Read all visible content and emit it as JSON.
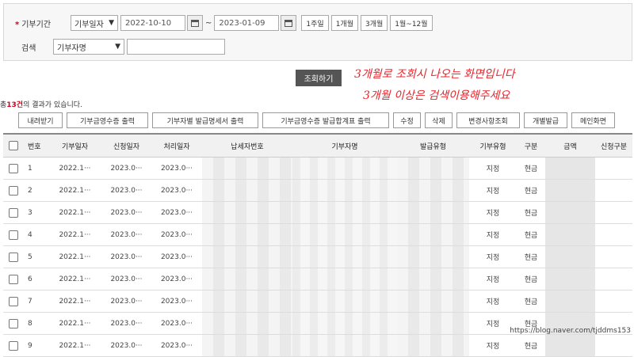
{
  "search": {
    "period_label": "기부기간",
    "period_type": "기부일자",
    "date_from": "2022-10-10",
    "date_sep": "~",
    "date_to": "2023-01-09",
    "quick_buttons": [
      "1주일",
      "1개월",
      "3개월",
      "1월~12월"
    ],
    "keyword_label": "검색",
    "keyword_type": "기부자명",
    "keyword_value": "",
    "submit_label": "조회하기"
  },
  "annotations": {
    "line1": "3개월로 조회시 나오는 화면입니다",
    "line2": "3개월 이상은 검색이용해주세요"
  },
  "results": {
    "prefix": "총",
    "count": "13건",
    "suffix": "의 결과가 있습니다."
  },
  "actions": [
    "내려받기",
    "기부금영수증 출력",
    "기부자별 발급명세서 출력",
    "기부금영수증 발급합계표 출력",
    "수정",
    "삭제",
    "변경사항조회",
    "개별발급",
    "메인화면"
  ],
  "table": {
    "headers": [
      "번호",
      "기부일자",
      "신청일자",
      "처리일자",
      "납세자번호",
      "기부자명",
      "발급유형",
      "기부유형",
      "구분",
      "금액",
      "신청구분"
    ],
    "rows": [
      {
        "no": "1",
        "donate": "2022.1···",
        "apply": "2023.0···",
        "proc": "2023.0···",
        "type": "지정",
        "kind": "현금"
      },
      {
        "no": "2",
        "donate": "2022.1···",
        "apply": "2023.0···",
        "proc": "2023.0···",
        "type": "지정",
        "kind": "현금"
      },
      {
        "no": "3",
        "donate": "2022.1···",
        "apply": "2023.0···",
        "proc": "2023.0···",
        "type": "지정",
        "kind": "현금"
      },
      {
        "no": "4",
        "donate": "2022.1···",
        "apply": "2023.0···",
        "proc": "2023.0···",
        "type": "지정",
        "kind": "현금"
      },
      {
        "no": "5",
        "donate": "2022.1···",
        "apply": "2023.0···",
        "proc": "2023.0···",
        "type": "지정",
        "kind": "현금"
      },
      {
        "no": "6",
        "donate": "2022.1···",
        "apply": "2023.0···",
        "proc": "2023.0···",
        "type": "지정",
        "kind": "현금"
      },
      {
        "no": "7",
        "donate": "2022.1···",
        "apply": "2023.0···",
        "proc": "2023.0···",
        "type": "지정",
        "kind": "현금"
      },
      {
        "no": "8",
        "donate": "2022.1···",
        "apply": "2023.0···",
        "proc": "2023.0···",
        "type": "지정",
        "kind": "현금"
      },
      {
        "no": "9",
        "donate": "2022.1···",
        "apply": "2023.0···",
        "proc": "2023.0···",
        "type": "지정",
        "kind": "현금"
      }
    ]
  },
  "watermark": "https://blog.naver.com/tjddms153",
  "colors": {
    "accent_red": "#d0021b",
    "button_dark": "#555555",
    "note_red": "#e8242b"
  },
  "icons": {
    "calendar": "calendar-icon",
    "dropdown": "chevron-down-icon",
    "checkbox": "checkbox"
  }
}
